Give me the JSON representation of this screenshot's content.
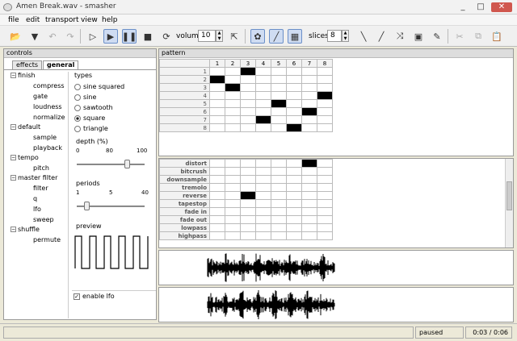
{
  "window": {
    "title": "Amen Break.wav - smasher",
    "min": "_",
    "max": "□",
    "close": "✕"
  },
  "menu": [
    "file",
    "edit",
    "transport",
    "view",
    "help"
  ],
  "toolbar": {
    "volume_label": "volume",
    "volume_value": "10",
    "slices_label": "slices",
    "slices_value": "8"
  },
  "controls": {
    "title": "controls",
    "tabs": [
      "effects",
      "general"
    ],
    "tree": [
      {
        "label": "finish",
        "children": [
          "compress",
          "gate",
          "loudness",
          "normalize"
        ]
      },
      {
        "label": "default",
        "children": [
          "sample",
          "playback"
        ]
      },
      {
        "label": "tempo",
        "children": [
          "pitch"
        ]
      },
      {
        "label": "master filter",
        "children": [
          "filter",
          "q",
          "lfo",
          "sweep"
        ]
      },
      {
        "label": "shuffle",
        "children": [
          "permute"
        ]
      }
    ],
    "types_label": "types",
    "types": [
      "sine squared",
      "sine",
      "sawtooth",
      "square",
      "triangle"
    ],
    "selected_type": "square",
    "depth_label": "depth (%)",
    "depth_ticks": [
      "0",
      "80",
      "100"
    ],
    "depth_value": 80,
    "periods_label": "periods",
    "periods_ticks": [
      "1",
      "5",
      "40"
    ],
    "periods_value": 5,
    "preview_label": "preview",
    "enable_lfo_label": "enable lfo",
    "enable_lfo": true
  },
  "pattern": {
    "title": "pattern",
    "columns": [
      "1",
      "2",
      "3",
      "4",
      "5",
      "6",
      "7",
      "8"
    ],
    "rows": [
      "1",
      "2",
      "3",
      "4",
      "5",
      "6",
      "7",
      "8"
    ],
    "cells": [
      [
        2
      ],
      [
        0
      ],
      [
        1
      ],
      [
        7
      ],
      [
        4
      ],
      [
        6
      ],
      [
        3
      ],
      [
        5
      ]
    ],
    "ghost_cells": [
      [],
      [],
      [],
      [],
      [],
      [],
      [
        3
      ],
      []
    ],
    "effects": [
      "distort",
      "bitcrush",
      "downsample",
      "tremolo",
      "reverse",
      "tapestop",
      "fade in",
      "fade out",
      "lowpass",
      "highpass"
    ],
    "effect_cells": [
      [
        6
      ],
      [],
      [],
      [],
      [
        2
      ],
      [],
      [],
      [],
      [],
      []
    ]
  },
  "status": {
    "state": "paused",
    "time": "0:03 / 0:06"
  }
}
